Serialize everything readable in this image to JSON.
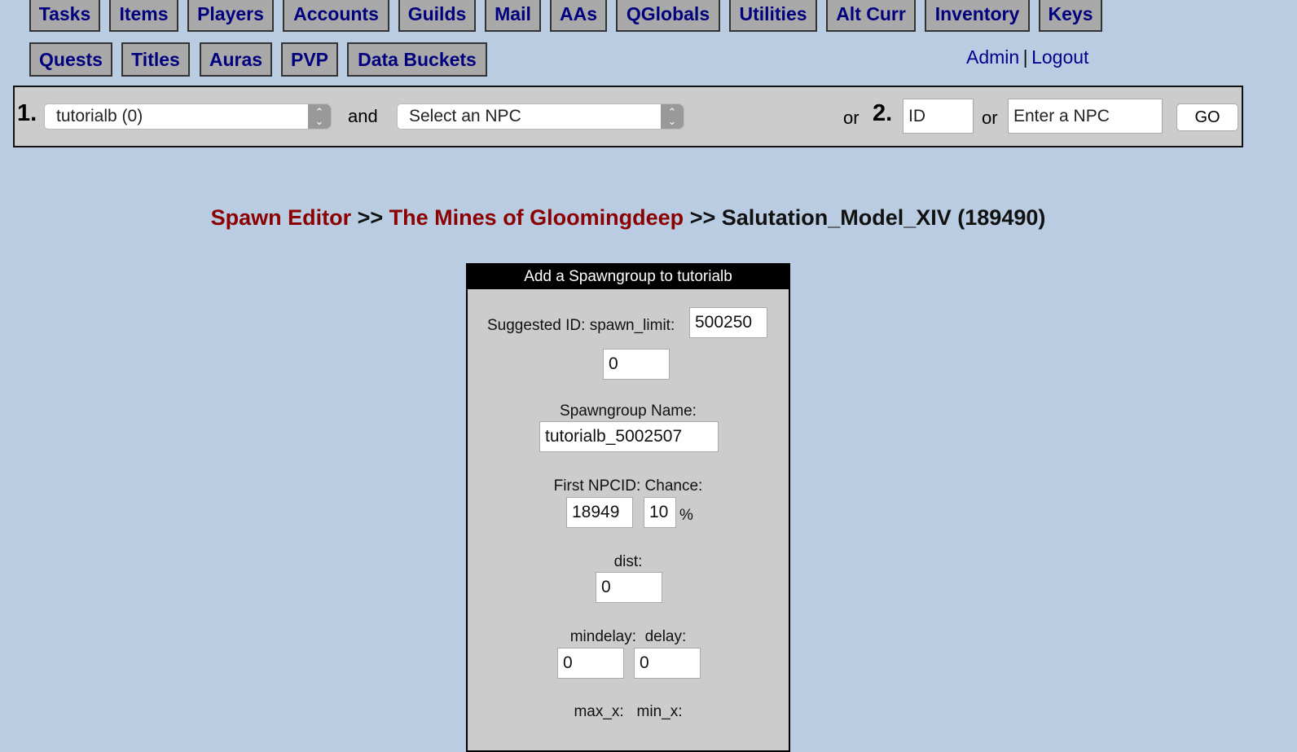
{
  "nav_row1": [
    "Tasks",
    "Items",
    "Players",
    "Accounts",
    "Guilds",
    "Mail",
    "AAs",
    "QGlobals",
    "Utilities",
    "Alt Curr",
    "Inventory",
    "Keys"
  ],
  "nav_row2": [
    "Quests",
    "Titles",
    "Auras",
    "PVP",
    "Data Buckets"
  ],
  "user_links": {
    "admin": "Admin",
    "sep": "|",
    "logout": "Logout"
  },
  "search": {
    "step1": "1.",
    "zone_select": "tutorialb (0)",
    "and": "and",
    "npc_select": "Select an NPC",
    "or1": "or",
    "step2": "2.",
    "id_placeholder": "ID",
    "or2": "or",
    "npc_placeholder": "Enter a NPC",
    "go": "GO"
  },
  "breadcrumb": {
    "editor": "Spawn Editor",
    "sep1": " >> ",
    "zone": "The Mines of Gloomingdeep",
    "sep2": " >> ",
    "npc": "Salutation_Model_XIV (189490)"
  },
  "form": {
    "title": "Add a Spawngroup to tutorialb",
    "suggested_label": "Suggested ID: spawn_limit:",
    "suggested_id": "500250",
    "spawn_limit": "0",
    "name_label": "Spawngroup Name:",
    "name_value": "tutorialb_5002507",
    "npc_chance_label": "First NPCID: Chance:",
    "npcid": "18949",
    "chance": "10",
    "pct": "%",
    "dist_label": "dist:",
    "dist": "0",
    "delay_label": "mindelay:  delay:",
    "mindelay": "0",
    "delay": "0",
    "max_min_label": "max_x:   min_x:"
  }
}
